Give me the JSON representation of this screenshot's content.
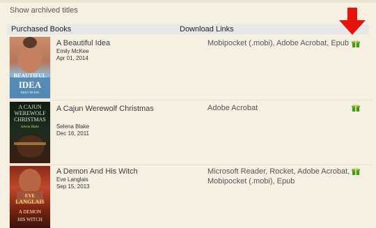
{
  "archived_label": "Show archived titles",
  "headers": {
    "purchased": "Purchased Books",
    "downloads": "Download Links"
  },
  "books": [
    {
      "title": "A Beautiful Idea",
      "author": "Emily McKee",
      "date": "Apr 01, 2014",
      "formats_lines": [
        "Mobipocket (.mobi), Adobe Acrobat, Epub"
      ],
      "cover": {
        "line1": "BEAUTIFUL",
        "line2": "IDEA",
        "author": "EMILY MCKEE"
      }
    },
    {
      "title": "A Cajun Werewolf Christmas",
      "author": "Selena Blake",
      "date": "Dec 16, 2011",
      "formats_lines": [
        "Adobe Acrobat"
      ],
      "cover": {
        "line1": "A CAJUN",
        "line2": "WEREWOLF",
        "line3": "CHRISTMAS",
        "author": "Selena Blake"
      }
    },
    {
      "title": "A Demon And His Witch",
      "author": "Eve Langlais",
      "date": "Sep 15, 2013",
      "formats_lines": [
        "Microsoft Reader, Rocket, Adobe Acrobat,",
        "Mobipocket (.mobi), Epub"
      ],
      "cover": {
        "line1": "EVE",
        "line2": "LANGLAIS",
        "line3": "A DEMON",
        "line4": "HIS WITCH"
      }
    }
  ],
  "colors": {
    "background": "#f5f0e2",
    "header_bg": "#e8e8e8",
    "annotation_arrow": "#e8120c",
    "gift_green": "#3e9b2a"
  },
  "icons": [
    "download-gift-icon",
    "red-arrow-icon"
  ]
}
